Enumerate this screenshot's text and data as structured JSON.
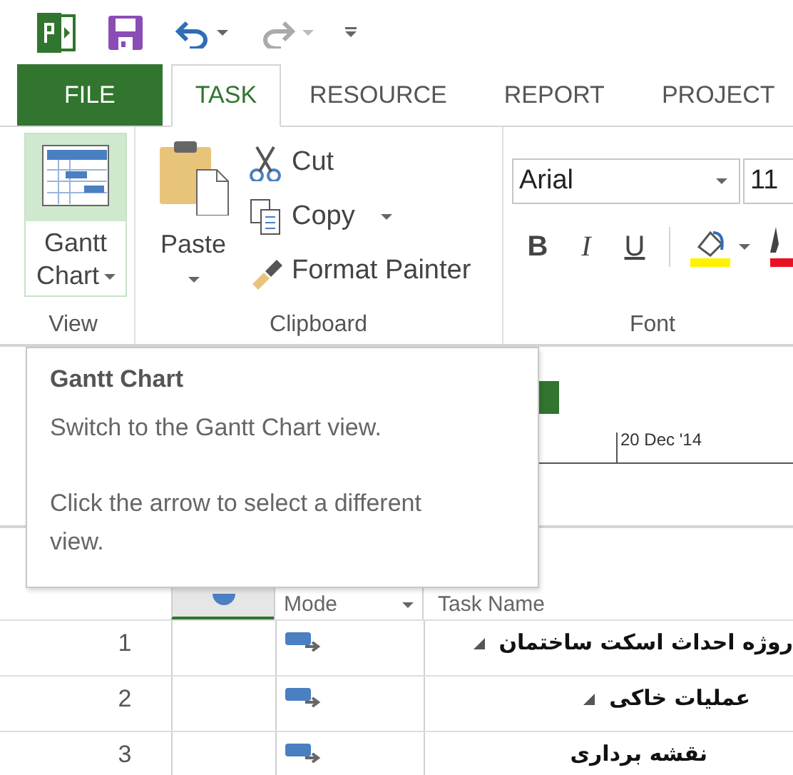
{
  "tabs": [
    {
      "label": "FILE",
      "kind": "file",
      "selected": false
    },
    {
      "label": "TASK",
      "kind": "tab",
      "selected": true
    },
    {
      "label": "RESOURCE",
      "kind": "tab",
      "selected": false
    },
    {
      "label": "REPORT",
      "kind": "tab",
      "selected": false
    },
    {
      "label": "PROJECT",
      "kind": "tab",
      "selected": false
    }
  ],
  "ribbon": {
    "view_group": {
      "label": "View",
      "gantt_button": {
        "label": "Gantt Chart",
        "selected": true
      }
    },
    "clipboard_group": {
      "label": "Clipboard",
      "paste": "Paste",
      "commands": [
        {
          "kind": "cut",
          "label": "Cut"
        },
        {
          "kind": "copy",
          "label": "Copy"
        },
        {
          "kind": "painter",
          "label": "Format Painter"
        }
      ]
    },
    "font_group": {
      "label": "Font",
      "font_name": "Arial",
      "font_size": "11",
      "styles": [
        {
          "kind": "bold",
          "label": "B"
        },
        {
          "kind": "italic",
          "label": "I"
        },
        {
          "kind": "underline",
          "label": "U"
        }
      ]
    }
  },
  "timeline": {
    "date": "20 Dec '14"
  },
  "tooltip": {
    "title": "Gantt Chart",
    "paragraphs": [
      "Switch to the Gantt Chart view.",
      "Click the arrow to select a different view."
    ]
  },
  "table": {
    "columns": [
      {
        "label": "Mode"
      },
      {
        "label": "Task Name"
      }
    ],
    "rows": [
      {
        "id": "1",
        "name": "روژه احداث اسکت ساختمان",
        "expanded": true,
        "children": [
          {
            "id": "2",
            "name": "عملیات خاکی",
            "expanded": true,
            "children": [
              {
                "id": "3",
                "name": "نقشه برداری",
                "expanded": false
              }
            ]
          }
        ]
      }
    ]
  }
}
